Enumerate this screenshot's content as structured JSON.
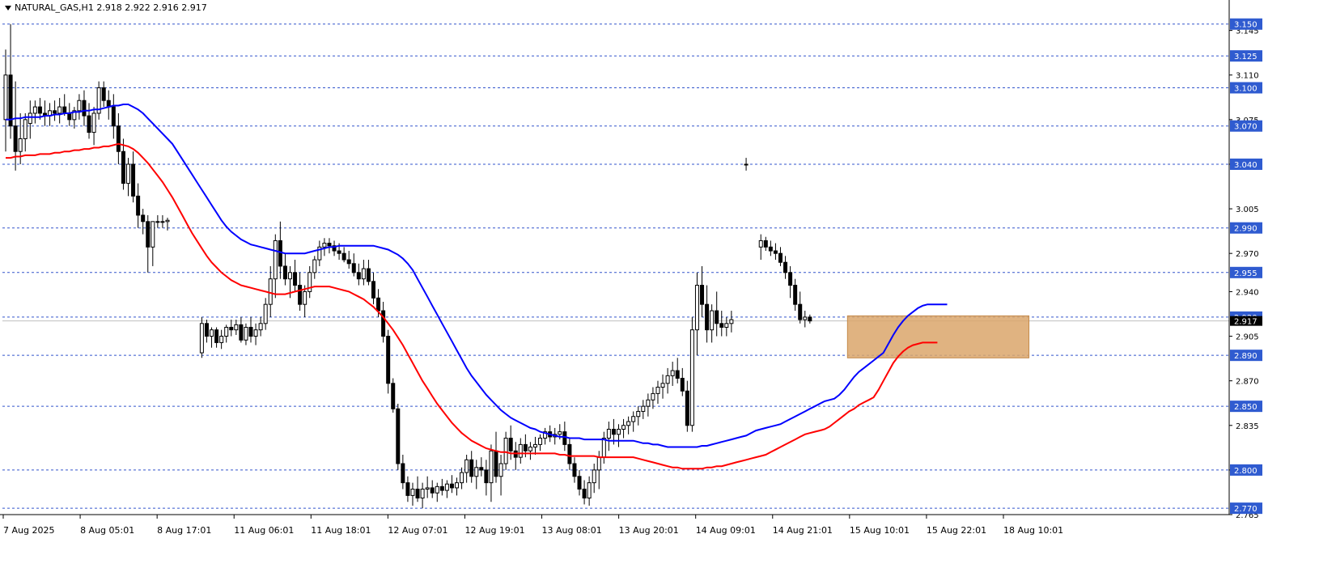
{
  "header": {
    "symbol_line": "NATURAL_GAS,H1  2.918 2.922 2.916 2.917"
  },
  "colors": {
    "ema_fast": "#0000ff",
    "ema_slow": "#ff0000",
    "level_line": "#3355cc",
    "level_label_bg": "#2f5bd0",
    "zone": "#dba66b",
    "candle_bull": "#ffffff",
    "candle_bear": "#000000",
    "price_marker_bg": "#000000"
  },
  "chart_data": {
    "type": "candlestick",
    "ylim": [
      2.765,
      3.16
    ],
    "y_ticks": [
      "3.145",
      "3.110",
      "3.075",
      "3.040",
      "3.005",
      "2.970",
      "2.940",
      "2.905",
      "2.870",
      "2.835",
      "2.800",
      "2.765"
    ],
    "x_tick_labels": [
      "7 Aug 2025",
      "8 Aug 05:01",
      "8 Aug 17:01",
      "11 Aug 06:01",
      "11 Aug 18:01",
      "12 Aug 07:01",
      "12 Aug 19:01",
      "13 Aug 08:01",
      "13 Aug 20:01",
      "14 Aug 09:01",
      "14 Aug 21:01",
      "15 Aug 10:01",
      "15 Aug 22:01",
      "18 Aug 10:01"
    ],
    "levels": [
      {
        "label": "3.150",
        "value": 3.15
      },
      {
        "label": "3.125",
        "value": 3.125
      },
      {
        "label": "3.100",
        "value": 3.1
      },
      {
        "label": "3.070",
        "value": 3.07
      },
      {
        "label": "3.040",
        "value": 3.04
      },
      {
        "label": "2.990",
        "value": 2.99
      },
      {
        "label": "2.955",
        "value": 2.955
      },
      {
        "label": "2.920",
        "value": 2.92
      },
      {
        "label": "2.890",
        "value": 2.89
      },
      {
        "label": "2.850",
        "value": 2.85
      },
      {
        "label": "2.800",
        "value": 2.8
      },
      {
        "label": "2.770",
        "value": 2.77
      }
    ],
    "current_price": {
      "label": "2.917",
      "value": 2.917
    },
    "zone": {
      "y_top": 2.921,
      "y_bottom": 2.888,
      "x_start_bar": 172,
      "x_end_bar": 209
    },
    "ema_fast": [
      3.075,
      3.075,
      3.076,
      3.076,
      3.077,
      3.077,
      3.077,
      3.077,
      3.078,
      3.078,
      3.079,
      3.079,
      3.08,
      3.08,
      3.081,
      3.081,
      3.082,
      3.082,
      3.083,
      3.083,
      3.084,
      3.085,
      3.086,
      3.086,
      3.087,
      3.087,
      3.085,
      3.083,
      3.08,
      3.076,
      3.072,
      3.068,
      3.064,
      3.06,
      3.056,
      3.05,
      3.044,
      3.038,
      3.032,
      3.026,
      3.02,
      3.014,
      3.008,
      3.002,
      2.996,
      2.991,
      2.987,
      2.984,
      2.981,
      2.979,
      2.977,
      2.976,
      2.975,
      2.974,
      2.973,
      2.972,
      2.971,
      2.97,
      2.97,
      2.97,
      2.97,
      2.97,
      2.971,
      2.972,
      2.973,
      2.974,
      2.975,
      2.975,
      2.976,
      2.976,
      2.976,
      2.976,
      2.976,
      2.976,
      2.976,
      2.976,
      2.975,
      2.974,
      2.973,
      2.971,
      2.969,
      2.966,
      2.962,
      2.957,
      2.95,
      2.943,
      2.936,
      2.929,
      2.922,
      2.915,
      2.908,
      2.901,
      2.894,
      2.887,
      2.88,
      2.874,
      2.869,
      2.864,
      2.859,
      2.855,
      2.851,
      2.847,
      2.844,
      2.841,
      2.839,
      2.837,
      2.835,
      2.833,
      2.832,
      2.83,
      2.829,
      2.828,
      2.827,
      2.826,
      2.826,
      2.825,
      2.825,
      2.825,
      2.824,
      2.824,
      2.824,
      2.824,
      2.824,
      2.823,
      2.823,
      2.823,
      2.823,
      2.823,
      2.823,
      2.822,
      2.821,
      2.821,
      2.82,
      2.82,
      2.819,
      2.818,
      2.818,
      2.818,
      2.818,
      2.818,
      2.818,
      2.818,
      2.819,
      2.819,
      2.82,
      2.821,
      2.822,
      2.823,
      2.824,
      2.825,
      2.826,
      2.827,
      2.829,
      2.831,
      2.832,
      2.833,
      2.834,
      2.835,
      2.836,
      2.838,
      2.84,
      2.842,
      2.844,
      2.846,
      2.848,
      2.85,
      2.852,
      2.854,
      2.855,
      2.856,
      2.859,
      2.863,
      2.868,
      2.873,
      2.877,
      2.88,
      2.883,
      2.886,
      2.889,
      2.892,
      2.899,
      2.906,
      2.912,
      2.917,
      2.921,
      2.924,
      2.927,
      2.929,
      2.93,
      2.93,
      2.93,
      2.93,
      2.93
    ],
    "ema_slow": [
      3.045,
      3.045,
      3.046,
      3.046,
      3.047,
      3.047,
      3.047,
      3.048,
      3.048,
      3.048,
      3.049,
      3.049,
      3.05,
      3.05,
      3.051,
      3.051,
      3.052,
      3.052,
      3.053,
      3.053,
      3.054,
      3.054,
      3.055,
      3.056,
      3.055,
      3.054,
      3.052,
      3.049,
      3.045,
      3.041,
      3.036,
      3.031,
      3.026,
      3.02,
      3.014,
      3.007,
      3.0,
      2.993,
      2.986,
      2.98,
      2.974,
      2.968,
      2.963,
      2.959,
      2.955,
      2.952,
      2.949,
      2.947,
      2.945,
      2.944,
      2.943,
      2.942,
      2.941,
      2.94,
      2.939,
      2.938,
      2.938,
      2.938,
      2.939,
      2.94,
      2.941,
      2.942,
      2.943,
      2.944,
      2.944,
      2.944,
      2.944,
      2.943,
      2.942,
      2.941,
      2.94,
      2.938,
      2.936,
      2.934,
      2.931,
      2.928,
      2.924,
      2.92,
      2.915,
      2.91,
      2.904,
      2.898,
      2.891,
      2.884,
      2.877,
      2.87,
      2.864,
      2.858,
      2.852,
      2.847,
      2.842,
      2.837,
      2.833,
      2.829,
      2.826,
      2.823,
      2.821,
      2.819,
      2.817,
      2.816,
      2.815,
      2.814,
      2.814,
      2.813,
      2.813,
      2.813,
      2.813,
      2.813,
      2.813,
      2.813,
      2.813,
      2.813,
      2.813,
      2.812,
      2.812,
      2.811,
      2.811,
      2.811,
      2.811,
      2.811,
      2.811,
      2.81,
      2.81,
      2.81,
      2.81,
      2.81,
      2.81,
      2.81,
      2.81,
      2.809,
      2.808,
      2.807,
      2.806,
      2.805,
      2.804,
      2.803,
      2.802,
      2.802,
      2.801,
      2.801,
      2.801,
      2.801,
      2.801,
      2.802,
      2.802,
      2.803,
      2.803,
      2.804,
      2.805,
      2.806,
      2.807,
      2.808,
      2.809,
      2.81,
      2.811,
      2.812,
      2.814,
      2.816,
      2.818,
      2.82,
      2.822,
      2.824,
      2.826,
      2.828,
      2.829,
      2.83,
      2.831,
      2.832,
      2.834,
      2.837,
      2.84,
      2.843,
      2.846,
      2.848,
      2.851,
      2.853,
      2.855,
      2.857,
      2.863,
      2.87,
      2.877,
      2.884,
      2.889,
      2.893,
      2.896,
      2.898,
      2.899,
      2.9,
      2.9,
      2.9,
      2.9
    ],
    "candles": [
      [
        3.075,
        3.13,
        3.05,
        3.11
      ],
      [
        3.11,
        3.15,
        3.06,
        3.07
      ],
      [
        3.07,
        3.105,
        3.035,
        3.05
      ],
      [
        3.05,
        3.08,
        3.04,
        3.06
      ],
      [
        3.06,
        3.08,
        3.05,
        3.075
      ],
      [
        3.072,
        3.09,
        3.06,
        3.08
      ],
      [
        3.08,
        3.09,
        3.072,
        3.085
      ],
      [
        3.085,
        3.092,
        3.075,
        3.08
      ],
      [
        3.08,
        3.09,
        3.07,
        3.078
      ],
      [
        3.078,
        3.088,
        3.07,
        3.082
      ],
      [
        3.082,
        3.09,
        3.074,
        3.08
      ],
      [
        3.08,
        3.092,
        3.072,
        3.085
      ],
      [
        3.085,
        3.095,
        3.078,
        3.08
      ],
      [
        3.08,
        3.088,
        3.07,
        3.075
      ],
      [
        3.075,
        3.085,
        3.068,
        3.082
      ],
      [
        3.082,
        3.095,
        3.075,
        3.09
      ],
      [
        3.09,
        3.098,
        3.07,
        3.078
      ],
      [
        3.078,
        3.088,
        3.06,
        3.065
      ],
      [
        3.065,
        3.085,
        3.055,
        3.08
      ],
      [
        3.08,
        3.105,
        3.075,
        3.1
      ],
      [
        3.1,
        3.105,
        3.085,
        3.09
      ],
      [
        3.09,
        3.098,
        3.075,
        3.085
      ],
      [
        3.085,
        3.095,
        3.06,
        3.07
      ],
      [
        3.07,
        3.08,
        3.04,
        3.05
      ],
      [
        3.05,
        3.06,
        3.02,
        3.025
      ],
      [
        3.025,
        3.045,
        3.015,
        3.04
      ],
      [
        3.04,
        3.05,
        3.01,
        3.015
      ],
      [
        3.015,
        3.025,
        2.99,
        3.0
      ],
      [
        3.0,
        3.005,
        2.985,
        2.995
      ],
      [
        2.995,
        3.0,
        2.955,
        2.975
      ],
      [
        2.975,
        2.995,
        2.96,
        2.995
      ],
      [
        2.995,
        3.0,
        2.99,
        2.995
      ],
      [
        2.995,
        3.0,
        2.99,
        2.995
      ],
      [
        2.995,
        2.998,
        2.988,
        2.996
      ],
      [
        null,
        null,
        null,
        null
      ],
      [
        null,
        null,
        null,
        null
      ],
      [
        null,
        null,
        null,
        null
      ],
      [
        null,
        null,
        null,
        null
      ],
      [
        null,
        null,
        null,
        null
      ],
      [
        null,
        null,
        null,
        null
      ],
      [
        2.892,
        2.92,
        2.888,
        2.915
      ],
      [
        2.915,
        2.918,
        2.9,
        2.905
      ],
      [
        2.905,
        2.912,
        2.896,
        2.91
      ],
      [
        2.91,
        2.912,
        2.896,
        2.9
      ],
      [
        2.9,
        2.91,
        2.895,
        2.905
      ],
      [
        2.905,
        2.914,
        2.9,
        2.912
      ],
      [
        2.912,
        2.918,
        2.905,
        2.91
      ],
      [
        2.91,
        2.918,
        2.906,
        2.914
      ],
      [
        2.914,
        2.92,
        2.9,
        2.902
      ],
      [
        2.902,
        2.915,
        2.898,
        2.912
      ],
      [
        2.912,
        2.92,
        2.9,
        2.905
      ],
      [
        2.905,
        2.915,
        2.898,
        2.91
      ],
      [
        2.91,
        2.92,
        2.905,
        2.915
      ],
      [
        2.915,
        2.935,
        2.91,
        2.93
      ],
      [
        2.93,
        2.96,
        2.92,
        2.95
      ],
      [
        2.95,
        2.985,
        2.935,
        2.98
      ],
      [
        2.98,
        2.995,
        2.95,
        2.96
      ],
      [
        2.96,
        2.97,
        2.945,
        2.95
      ],
      [
        2.95,
        2.96,
        2.935,
        2.955
      ],
      [
        2.955,
        2.965,
        2.94,
        2.945
      ],
      [
        2.945,
        2.955,
        2.925,
        2.93
      ],
      [
        2.93,
        2.945,
        2.92,
        2.94
      ],
      [
        2.94,
        2.96,
        2.935,
        2.955
      ],
      [
        2.955,
        2.968,
        2.95,
        2.965
      ],
      [
        2.965,
        2.98,
        2.96,
        2.975
      ],
      [
        2.975,
        2.982,
        2.968,
        2.978
      ],
      [
        2.978,
        2.982,
        2.97,
        2.976
      ],
      [
        2.976,
        2.98,
        2.968,
        2.972
      ],
      [
        2.972,
        2.978,
        2.965,
        2.97
      ],
      [
        2.97,
        2.975,
        2.963,
        2.965
      ],
      [
        2.965,
        2.972,
        2.958,
        2.962
      ],
      [
        2.962,
        2.97,
        2.952,
        2.955
      ],
      [
        2.955,
        2.962,
        2.945,
        2.95
      ],
      [
        2.95,
        2.965,
        2.945,
        2.958
      ],
      [
        2.958,
        2.965,
        2.945,
        2.948
      ],
      [
        2.948,
        2.955,
        2.93,
        2.935
      ],
      [
        2.935,
        2.942,
        2.92,
        2.925
      ],
      [
        2.925,
        2.932,
        2.9,
        2.905
      ],
      [
        2.905,
        2.91,
        2.86,
        2.868
      ],
      [
        2.868,
        2.872,
        2.845,
        2.848
      ],
      [
        2.848,
        2.852,
        2.8,
        2.805
      ],
      [
        2.805,
        2.812,
        2.785,
        2.79
      ],
      [
        2.79,
        2.795,
        2.775,
        2.78
      ],
      [
        2.78,
        2.79,
        2.772,
        2.785
      ],
      [
        2.785,
        2.795,
        2.775,
        2.778
      ],
      [
        2.778,
        2.79,
        2.77,
        2.785
      ],
      [
        2.785,
        2.795,
        2.778,
        2.786
      ],
      [
        2.786,
        2.792,
        2.778,
        2.782
      ],
      [
        2.782,
        2.79,
        2.775,
        2.787
      ],
      [
        2.787,
        2.793,
        2.78,
        2.784
      ],
      [
        2.784,
        2.792,
        2.778,
        2.789
      ],
      [
        2.789,
        2.796,
        2.782,
        2.786
      ],
      [
        2.786,
        2.794,
        2.78,
        2.79
      ],
      [
        2.79,
        2.802,
        2.785,
        2.798
      ],
      [
        2.798,
        2.812,
        2.79,
        2.808
      ],
      [
        2.808,
        2.815,
        2.79,
        2.795
      ],
      [
        2.795,
        2.808,
        2.785,
        2.802
      ],
      [
        2.802,
        2.81,
        2.795,
        2.8
      ],
      [
        2.8,
        2.808,
        2.78,
        2.79
      ],
      [
        2.79,
        2.82,
        2.775,
        2.815
      ],
      [
        2.815,
        2.83,
        2.79,
        2.795
      ],
      [
        2.795,
        2.812,
        2.78,
        2.805
      ],
      [
        2.805,
        2.83,
        2.8,
        2.825
      ],
      [
        2.825,
        2.835,
        2.808,
        2.815
      ],
      [
        2.815,
        2.822,
        2.8,
        2.81
      ],
      [
        2.81,
        2.825,
        2.805,
        2.82
      ],
      [
        2.82,
        2.828,
        2.81,
        2.815
      ],
      [
        2.815,
        2.822,
        2.808,
        2.818
      ],
      [
        2.818,
        2.826,
        2.812,
        2.82
      ],
      [
        2.82,
        2.828,
        2.815,
        2.825
      ],
      [
        2.825,
        2.833,
        2.82,
        2.83
      ],
      [
        2.83,
        2.835,
        2.822,
        2.826
      ],
      [
        2.826,
        2.833,
        2.82,
        2.828
      ],
      [
        2.828,
        2.836,
        2.824,
        2.83
      ],
      [
        2.83,
        2.838,
        2.815,
        2.82
      ],
      [
        2.82,
        2.825,
        2.8,
        2.805
      ],
      [
        2.805,
        2.81,
        2.79,
        2.795
      ],
      [
        2.795,
        2.8,
        2.78,
        2.785
      ],
      [
        2.785,
        2.792,
        2.773,
        2.778
      ],
      [
        2.778,
        2.795,
        2.772,
        2.79
      ],
      [
        2.79,
        2.805,
        2.782,
        2.8
      ],
      [
        2.8,
        2.815,
        2.785,
        2.81
      ],
      [
        2.81,
        2.83,
        2.805,
        2.825
      ],
      [
        2.825,
        2.838,
        2.815,
        2.832
      ],
      [
        2.832,
        2.84,
        2.82,
        2.828
      ],
      [
        2.828,
        2.836,
        2.818,
        2.832
      ],
      [
        2.832,
        2.84,
        2.825,
        2.835
      ],
      [
        2.835,
        2.842,
        2.828,
        2.838
      ],
      [
        2.838,
        2.846,
        2.83,
        2.842
      ],
      [
        2.842,
        2.85,
        2.835,
        2.846
      ],
      [
        2.846,
        2.855,
        2.84,
        2.85
      ],
      [
        2.85,
        2.86,
        2.842,
        2.855
      ],
      [
        2.855,
        2.865,
        2.848,
        2.86
      ],
      [
        2.86,
        2.87,
        2.852,
        2.865
      ],
      [
        2.865,
        2.875,
        2.856,
        2.868
      ],
      [
        2.868,
        2.88,
        2.86,
        2.874
      ],
      [
        2.874,
        2.885,
        2.866,
        2.878
      ],
      [
        2.878,
        2.888,
        2.868,
        2.872
      ],
      [
        2.872,
        2.88,
        2.858,
        2.862
      ],
      [
        2.862,
        2.87,
        2.83,
        2.835
      ],
      [
        2.835,
        2.92,
        2.83,
        2.91
      ],
      [
        2.91,
        2.955,
        2.89,
        2.945
      ],
      [
        2.945,
        2.96,
        2.92,
        2.93
      ],
      [
        2.93,
        2.945,
        2.9,
        2.91
      ],
      [
        2.91,
        2.93,
        2.9,
        2.925
      ],
      [
        2.925,
        2.94,
        2.905,
        2.915
      ],
      [
        2.915,
        2.925,
        2.905,
        2.912
      ],
      [
        2.912,
        2.92,
        2.905,
        2.915
      ],
      [
        2.915,
        2.925,
        2.908,
        2.918
      ],
      [
        null,
        null,
        null,
        null
      ],
      [
        null,
        null,
        null,
        null
      ],
      [
        3.04,
        3.045,
        3.035,
        3.04
      ],
      [
        null,
        null,
        null,
        null
      ],
      [
        null,
        null,
        null,
        null
      ],
      [
        2.975,
        2.985,
        2.965,
        2.98
      ],
      [
        2.98,
        2.983,
        2.972,
        2.975
      ],
      [
        2.975,
        2.98,
        2.968,
        2.972
      ],
      [
        2.972,
        2.978,
        2.965,
        2.97
      ],
      [
        2.97,
        2.975,
        2.96,
        2.963
      ],
      [
        2.963,
        2.968,
        2.95,
        2.955
      ],
      [
        2.955,
        2.96,
        2.935,
        2.945
      ],
      [
        2.945,
        2.95,
        2.925,
        2.93
      ],
      [
        2.93,
        2.94,
        2.915,
        2.918
      ],
      [
        2.918,
        2.925,
        2.912,
        2.92
      ],
      [
        2.92,
        2.922,
        2.915,
        2.917
      ]
    ]
  }
}
